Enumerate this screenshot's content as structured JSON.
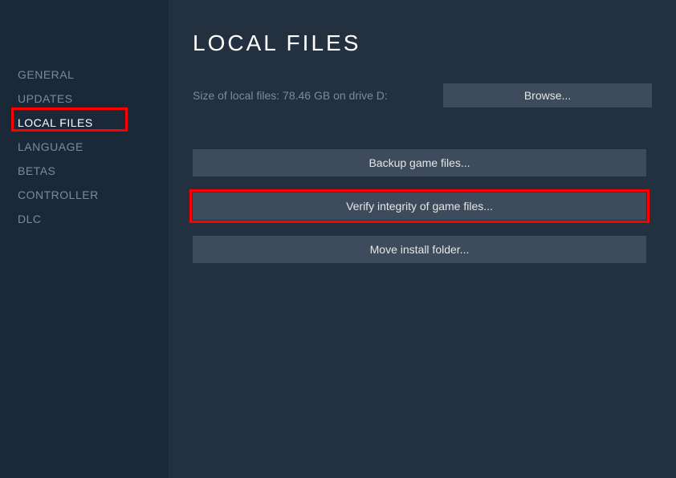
{
  "sidebar": {
    "items": [
      {
        "label": "General"
      },
      {
        "label": "Updates"
      },
      {
        "label": "Local Files"
      },
      {
        "label": "Language"
      },
      {
        "label": "Betas"
      },
      {
        "label": "Controller"
      },
      {
        "label": "DLC"
      }
    ]
  },
  "main": {
    "title": "Local Files",
    "size_text": "Size of local files: 78.46 GB on drive D:",
    "browse_label": "Browse...",
    "backup_label": "Backup game files...",
    "verify_label": "Verify integrity of game files...",
    "move_label": "Move install folder..."
  }
}
